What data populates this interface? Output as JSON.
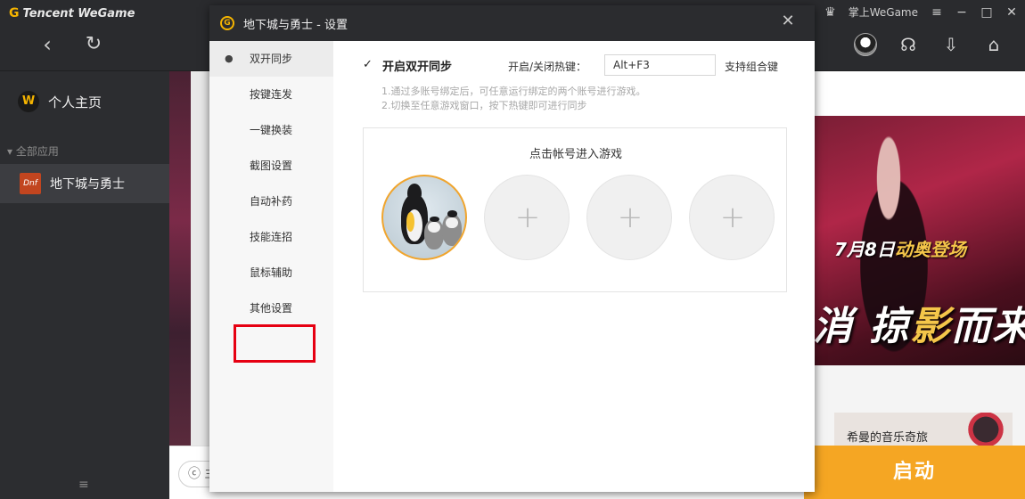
{
  "app": {
    "brand": "Tencent WeGame",
    "brand_logo": "G",
    "mobile_wegame": "掌上WeGame",
    "back_icon": "‹",
    "refresh_icon": "↻"
  },
  "sidebar": {
    "profile_label": "个人主页",
    "profile_logo": "W",
    "section_title": "全部应用",
    "game_label": "地下城与勇士",
    "game_icon_text": "Dnf"
  },
  "content": {
    "banner_date": "7月8日",
    "banner_date_suffix": "动奥登场",
    "banner_slogan_1": "消 掠",
    "banner_slogan_gold": "影",
    "banner_slogan_2": "而来",
    "news_title": "希曼的音乐奇旅",
    "start_label": "启动",
    "search_prefix": "ⓒ 主"
  },
  "dialog": {
    "title": "地下城与勇士 - 设置",
    "logo": "G",
    "close_icon": "✕",
    "nav": [
      {
        "label": "双开同步"
      },
      {
        "label": "按键连发"
      },
      {
        "label": "一键换装"
      },
      {
        "label": "截图设置"
      },
      {
        "label": "自动补药"
      },
      {
        "label": "技能连招"
      },
      {
        "label": "鼠标辅助"
      },
      {
        "label": "其他设置"
      }
    ],
    "active_nav": "双开同步",
    "sync": {
      "checkbox_label": "开启双开同步",
      "checked": true,
      "hotkey_label": "开启/关闭热键：",
      "hotkey_value": "Alt+F3",
      "hotkey_hint": "支持组合键",
      "tips": [
        "1.通过多账号绑定后，可任意运行绑定的两个账号进行游戏。",
        "2.切换至任意游戏窗口，按下热键即可进行同步"
      ]
    },
    "accounts": {
      "panel_title": "点击帐号进入游戏",
      "add_slots": 3
    }
  },
  "colors": {
    "accent": "#f5a623",
    "highlight_box": "#e60012",
    "dark_chrome": "#2b2c2f"
  }
}
